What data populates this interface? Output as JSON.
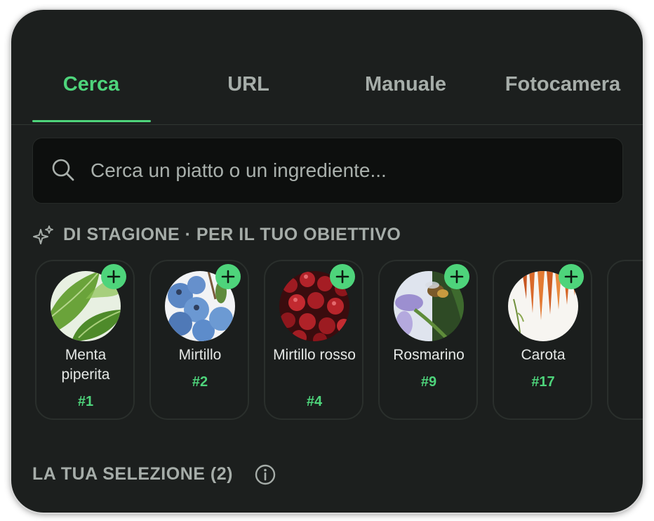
{
  "tabs": [
    {
      "label": "Cerca",
      "active": true
    },
    {
      "label": "URL",
      "active": false
    },
    {
      "label": "Manuale",
      "active": false
    },
    {
      "label": "Fotocamera",
      "active": false
    }
  ],
  "search": {
    "placeholder": "Cerca un piatto o un ingrediente..."
  },
  "seasonal": {
    "title": "DI STAGIONE · PER IL TUO OBIETTIVO",
    "icon": "sparkles-icon",
    "items": [
      {
        "name": "Menta piperita",
        "rank": "#1",
        "image": "mint-leaves"
      },
      {
        "name": "Mirtillo",
        "rank": "#2",
        "image": "blueberries"
      },
      {
        "name": "Mirtillo rosso",
        "rank": "#4",
        "image": "cranberries"
      },
      {
        "name": "Rosmarino",
        "rank": "#9",
        "image": "rosemary-flower"
      },
      {
        "name": "Carota",
        "rank": "#17",
        "image": "carrots"
      }
    ]
  },
  "selection": {
    "title": "LA TUA SELEZIONE (2)",
    "icon": "info-icon"
  },
  "colors": {
    "accent": "#4ed47b",
    "background": "#1c1f1e",
    "muted_text": "#a6ada9"
  }
}
